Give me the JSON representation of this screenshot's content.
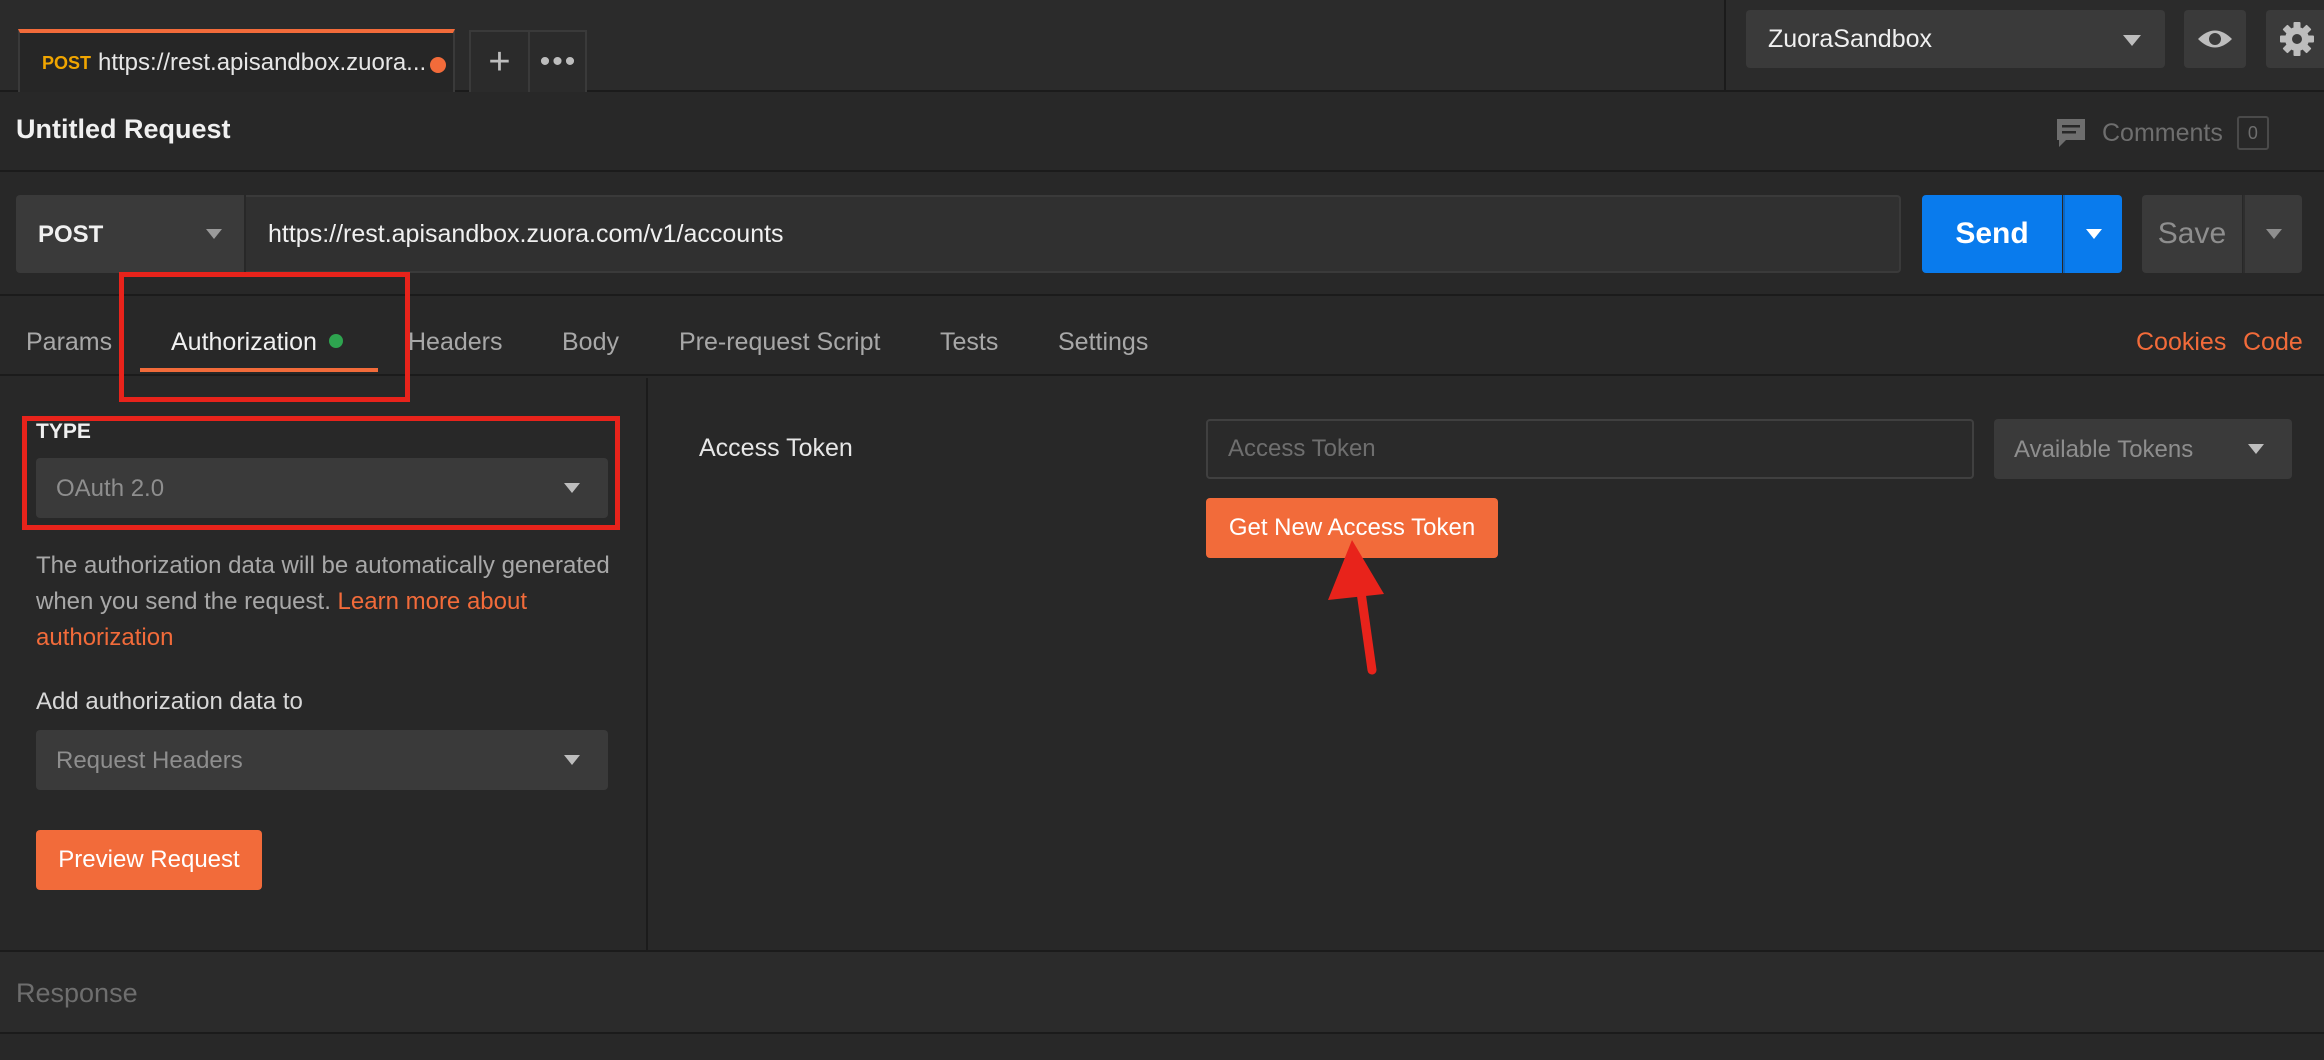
{
  "tab": {
    "method": "POST",
    "url": "https://rest.apisandbox.zuora...."
  },
  "tab_actions": {
    "new": "+",
    "more": "•••"
  },
  "environment": {
    "selected": "ZuoraSandbox"
  },
  "request": {
    "title": "Untitled Request",
    "comments_label": "Comments",
    "comments_count": "0",
    "method": "POST",
    "url": "https://rest.apisandbox.zuora.com/v1/accounts",
    "send_label": "Send",
    "save_label": "Save"
  },
  "request_tabs": [
    "Params",
    "Authorization",
    "Headers",
    "Body",
    "Pre-request Script",
    "Tests",
    "Settings"
  ],
  "right_links": {
    "cookies": "Cookies",
    "code": "Code"
  },
  "auth": {
    "type_label": "TYPE",
    "type_value": "OAuth 2.0",
    "description": "The authorization data will be automatically generated when you send the request.",
    "learn_more": "Learn more about authorization",
    "add_to_label": "Add authorization data to",
    "add_to_value": "Request Headers",
    "preview_label": "Preview Request",
    "access_token_label": "Access Token",
    "access_token_placeholder": "Access Token",
    "available_tokens": "Available Tokens",
    "get_token_label": "Get New Access Token"
  },
  "response": {
    "label": "Response"
  },
  "colors": {
    "accent": "#f26b3a",
    "primary": "#097bed",
    "annotation": "#e8231b",
    "status_dot": "#2ea44f"
  }
}
